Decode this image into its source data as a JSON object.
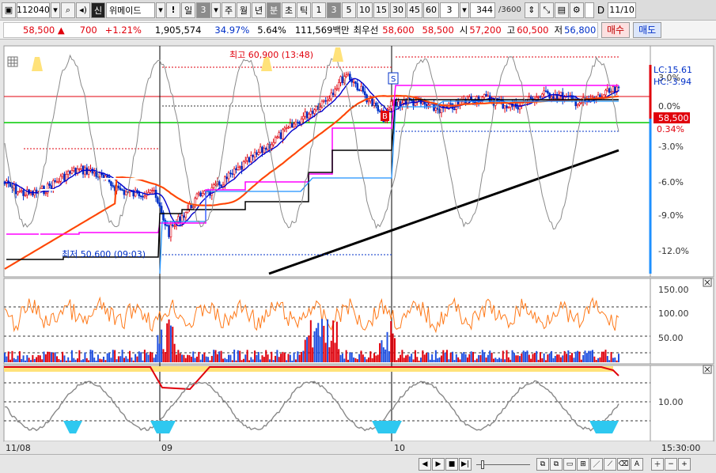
{
  "toolbar": {
    "code": "112040",
    "credit_badge": "신",
    "name": "위메이드",
    "alert": "!",
    "period_label": "일",
    "period_value": "3",
    "periods": [
      "주",
      "월",
      "년",
      "분",
      "초",
      "틱"
    ],
    "selected_period": "분",
    "minute_options": [
      "1",
      "3",
      "5",
      "10",
      "15",
      "30",
      "45",
      "60"
    ],
    "selected_minute": "3",
    "multiplier": "3",
    "count": "344",
    "max_count": "/3600",
    "date": "11/10",
    "date_flag": "D"
  },
  "quote": {
    "price": "58,500",
    "direction": "▲",
    "change": "700",
    "change_pct": "+1.21%",
    "volume": "1,905,574",
    "turnover_pct": "34.97%",
    "ratio": "5.64%",
    "amount": "111,569백만",
    "best_label": "최우선",
    "ask": "58,600",
    "bid": "58,500",
    "open_label": "시",
    "open": "57,200",
    "high_label": "고",
    "high": "60,500",
    "low_label": "저",
    "low": "56,800",
    "buy_label": "매수",
    "sell_label": "매도"
  },
  "colors": {
    "price_up": "#e0000c",
    "price_down": "#0030c8",
    "ma_short": "#0000cc",
    "ma_mid": "#ff6a00",
    "trend": "#000000",
    "envelope": "#ff00ff",
    "support_line": "#00cc00",
    "channel": "#1e90ff"
  },
  "price_panel": {
    "lc": "LC:15.61",
    "hc": "HC:-3.94",
    "current": "58,500",
    "current_pct": "0.34%",
    "pct_ticks": [
      "3.0%",
      "0.0%",
      "-3.0%",
      "-6.0%",
      "-9.0%",
      "-12.0%"
    ],
    "high_label": "최고 60,900 (13:48)",
    "low_label": "최저 50,600 (09:03)",
    "marker_s": "S",
    "marker_b": "B"
  },
  "volume_panel": {
    "ticks": [
      "150.00",
      "100.00",
      "50.00"
    ]
  },
  "osc_panel": {
    "ticks": [
      "10.00"
    ]
  },
  "x_axis": {
    "dates": [
      "11/08",
      "09",
      "10"
    ],
    "time": "15:30:00"
  },
  "chart_data": {
    "type": "line",
    "title": "",
    "y_pct_range": [
      -15,
      6
    ],
    "reference_price": 58300,
    "day_separators": [
      "09",
      "10"
    ],
    "price_levels": {
      "high": 60900,
      "low": 50600,
      "current": 58500
    },
    "volume_axis": [
      0,
      150
    ],
    "osc_axis": [
      0,
      15
    ]
  }
}
